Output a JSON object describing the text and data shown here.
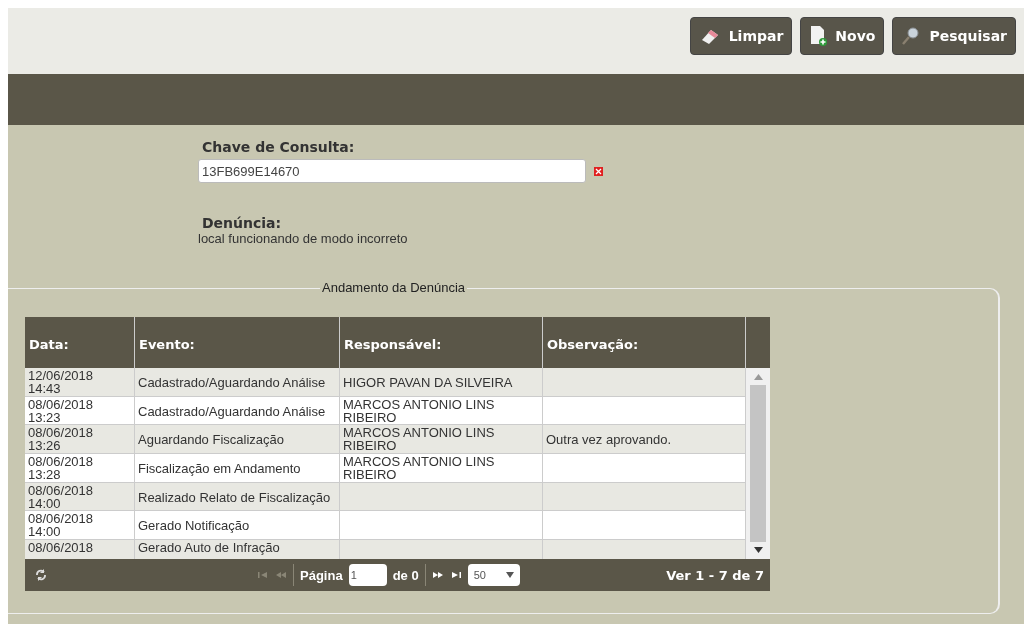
{
  "toolbar": {
    "buttons": [
      {
        "kind": "eraser",
        "label": "Limpar"
      },
      {
        "kind": "new",
        "label": "Novo"
      },
      {
        "kind": "search",
        "label": "Pesquisar"
      }
    ]
  },
  "form": {
    "key_label": "Chave de Consulta:",
    "key_value": "13FB699E14670",
    "complaint_label": "Denúncia:",
    "complaint_text": "local funcionando de modo incorreto"
  },
  "progress": {
    "legend": "Andamento da Denúncia",
    "table": {
      "columns": [
        "Data:",
        "Evento:",
        "Responsável:",
        "Observação:"
      ],
      "rows": [
        {
          "date": "12/06/2018",
          "time": "14:43",
          "event": "Cadastrado/Aguardando Análise",
          "responsible": "HIGOR PAVAN DA SILVEIRA",
          "note": ""
        },
        {
          "date": "08/06/2018",
          "time": "13:23",
          "event": "Cadastrado/Aguardando Análise",
          "responsible": "MARCOS ANTONIO LINS RIBEIRO",
          "note": ""
        },
        {
          "date": "08/06/2018",
          "time": "13:26",
          "event": "Aguardando Fiscalização",
          "responsible": "MARCOS ANTONIO LINS RIBEIRO",
          "note": "Outra vez aprovando."
        },
        {
          "date": "08/06/2018",
          "time": "13:28",
          "event": "Fiscalização em Andamento",
          "responsible": "MARCOS ANTONIO LINS RIBEIRO",
          "note": ""
        },
        {
          "date": "08/06/2018",
          "time": "14:00",
          "event": "Realizado Relato de Fiscalização",
          "responsible": "",
          "note": ""
        },
        {
          "date": "08/06/2018",
          "time": "14:00",
          "event": "Gerado Notificação",
          "responsible": "",
          "note": ""
        },
        {
          "date": "08/06/2018",
          "event": "Gerado Auto de Infração",
          "responsible": "",
          "note": ""
        }
      ]
    },
    "pager": {
      "nav": [
        {
          "kind": "first",
          "disabled": true
        },
        {
          "kind": "prev",
          "disabled": true
        }
      ],
      "page_label": "Página",
      "page_value": "1",
      "of_label": "de 0",
      "nav_after": [
        {
          "kind": "next",
          "disabled": false
        },
        {
          "kind": "last",
          "disabled": false
        }
      ],
      "page_size": "50",
      "summary": "Ver 1 - 7 de 7"
    }
  }
}
